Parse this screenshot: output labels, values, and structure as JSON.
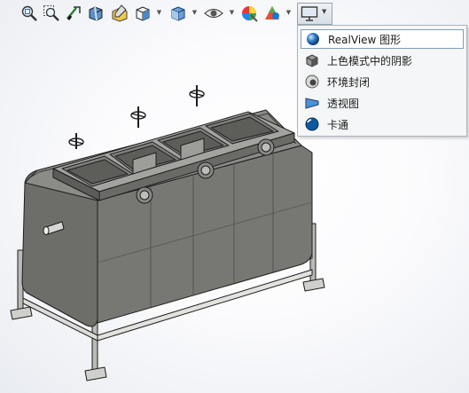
{
  "toolbar": {
    "tools": [
      {
        "icon": "zoom-to-fit-icon"
      },
      {
        "icon": "zoom-to-area-icon"
      },
      {
        "icon": "previous-view-icon"
      },
      {
        "icon": "section-view-icon"
      },
      {
        "icon": "dynamic-annotation-view-icon"
      },
      {
        "icon": "view-orientation-icon"
      },
      {
        "icon": "display-style-icon"
      },
      {
        "icon": "hide-show-items-icon"
      },
      {
        "icon": "edit-appearance-icon"
      },
      {
        "icon": "apply-scene-icon"
      },
      {
        "icon": "view-settings-icon"
      }
    ]
  },
  "view_settings_menu": {
    "items": [
      {
        "label": "RealView 图形",
        "icon": "realview-sphere-icon",
        "selected": true
      },
      {
        "label": "上色模式中的阴影",
        "icon": "shaded-shadows-cube-icon",
        "selected": false
      },
      {
        "label": "环境封闭",
        "icon": "ambient-occlusion-icon",
        "selected": false
      },
      {
        "label": "透视图",
        "icon": "perspective-icon",
        "selected": false
      },
      {
        "label": "卡通",
        "icon": "cartoon-sphere-icon",
        "selected": false
      }
    ]
  },
  "colors": {
    "menu_selected_border": "#7f9db9",
    "model_body": "#6f6f6c",
    "model_edges": "#1e1e1e"
  }
}
